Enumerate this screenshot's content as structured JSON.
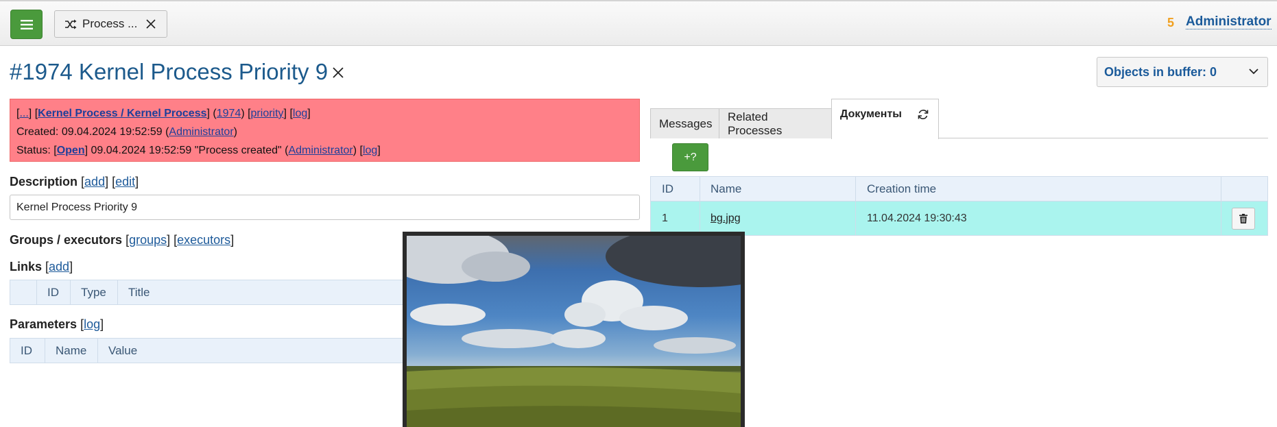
{
  "topbar": {
    "tab_label": "Process ...",
    "notification_count": "5",
    "user_name": "Administrator"
  },
  "page": {
    "title": "#1974 Kernel Process Priority 9"
  },
  "buffer": {
    "label": "Objects in buffer: 0"
  },
  "infobox": {
    "ellipsis": "...",
    "type_link": "Kernel Process / Kernel Process",
    "id_link": "1974",
    "priority_link": "priority",
    "log_link": "log",
    "created_prefix": "Created: 09.04.2024 19:52:59 (",
    "created_by": "Administrator",
    "status_prefix": "Status: [",
    "status_link": "Open",
    "status_text": "] 09.04.2024 19:52:59 \"Process created\" (",
    "status_by": "Administrator",
    "status_log": "log"
  },
  "description": {
    "label": "Description",
    "add_link": "add",
    "edit_link": "edit",
    "value": "Kernel Process Priority 9"
  },
  "groups": {
    "label": "Groups / executors",
    "groups_link": "groups",
    "executors_link": "executors"
  },
  "links": {
    "label": "Links",
    "add_link": "add",
    "columns": [
      "",
      "ID",
      "Type",
      "Title"
    ]
  },
  "parameters": {
    "label": "Parameters",
    "log_link": "log",
    "columns": [
      "ID",
      "Name",
      "Value"
    ]
  },
  "tabs": {
    "messages": "Messages",
    "related": "Related Processes",
    "documents": "Документы"
  },
  "documents": {
    "add_button": "+?",
    "columns": [
      "ID",
      "Name",
      "Creation time"
    ],
    "rows": [
      {
        "id": "1",
        "name": "bg.jpg",
        "created": "11.04.2024 19:30:43"
      }
    ]
  },
  "colors": {
    "accent_green": "#4a9a3c",
    "title_blue": "#1c5a8c",
    "status_red": "#ff8088",
    "row_highlight": "#aaf4ee"
  }
}
